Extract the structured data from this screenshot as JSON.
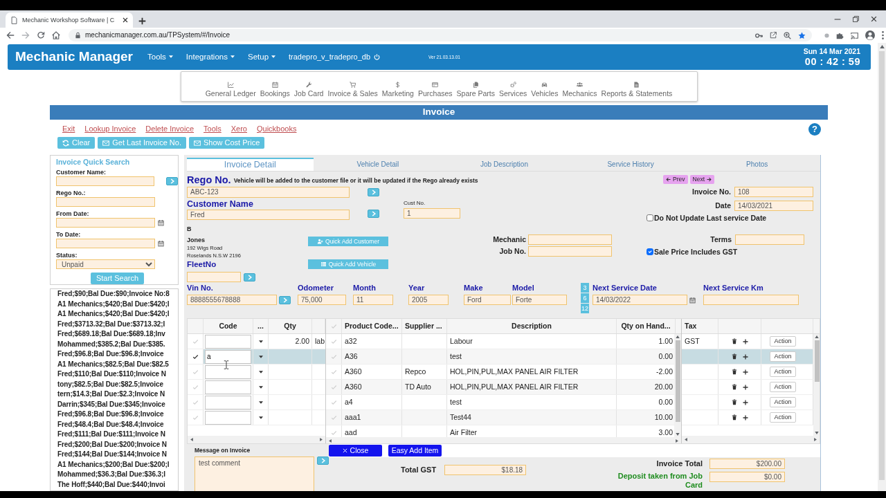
{
  "browser": {
    "tab_title": "Mechanic Workshop Software | C",
    "url": "mechanicmanager.com.au/TPSystem/#/Invoice"
  },
  "navbar": {
    "brand": "Mechanic Manager",
    "menus": [
      {
        "label": "Tools",
        "dropdown": true
      },
      {
        "label": "Integrations",
        "dropdown": true
      },
      {
        "label": "Setup",
        "dropdown": true
      }
    ],
    "database": "tradepro_v_tradepro_db",
    "version": "Ver 21.03.13.01",
    "date": "Sun 14 Mar 2021",
    "time": "00 : 42 : 59"
  },
  "modules": [
    "General Ledger",
    "Bookings",
    "Job Card",
    "Invoice & Sales",
    "Marketing",
    "Purchases",
    "Spare Parts",
    "Services",
    "Vehicles",
    "Mechanics",
    "Reports & Statements"
  ],
  "invoice": {
    "title": "Invoice",
    "links": [
      "Exit",
      "Lookup Invoice",
      "Delete Invoice",
      "Tools",
      "Xero",
      "Quickbooks"
    ],
    "buttons": [
      "Clear",
      "Get Last Invoice No.",
      "Show Cost Price"
    ],
    "help": "?"
  },
  "quick_search": {
    "title": "Invoice Quick Search",
    "fields": [
      {
        "label": "Customer Name:",
        "kind": "text",
        "go_button": true
      },
      {
        "label": "Rego No.:",
        "kind": "text",
        "go_button": false
      },
      {
        "label": "From Date:",
        "kind": "date",
        "go_button": false
      },
      {
        "label": "To Date:",
        "kind": "date",
        "go_button": false
      },
      {
        "label": "Status:",
        "kind": "select",
        "value": "Unpaid",
        "go_button": false
      }
    ],
    "button": "Start Search"
  },
  "results": [
    "Fred;$90;Bal Due:$90;Invoice No:8",
    "A1 Mechanics;$420;Bal Due:$420;I",
    "A1 Mechanics;$420;Bal Due:$420;I",
    "Fred;$3713.32;Bal Due:$3713.32;I",
    "Fred;$689.18;Bal Due:$689.18;Inv",
    "Mohammed;$385.2;Bal Due:$385.",
    "Fred;$96.8;Bal Due:$96.8;Invoice",
    "A1 Mechanics;$82.5;Bal Due:$82.5",
    "Fred;$110;Bal Due:$110;Invoice N",
    "tony;$82.5;Bal Due:$82.5;Invoice",
    "tern;$14.3;Bal Due:$2.3;Invoice N",
    "Darrin;$345;Bal Due:$345;Invoice",
    "Fred;$96.8;Bal Due:$96.8;Invoice",
    "Fred;$48.4;Bal Due:$48.4;Invoice",
    "Fred;$111;Bal Due:$111;Invoice N",
    "Fred;$200;Bal Due:$200;Invoice N",
    "Fred;$144;Bal Due:$144;Invoice N",
    "A1 Mechanics;$200;Bal Due:$200;I",
    "Mohammed;$36.3;Bal Due:$36.3;I",
    "The Hoff;$440;Bal Due:$440;Invoi"
  ],
  "tabs": [
    {
      "label": "Invoice Detail",
      "selected": true
    },
    {
      "label": "Vehicle Detail",
      "selected": false
    },
    {
      "label": "Job Description",
      "selected": false
    },
    {
      "label": "Service History",
      "selected": false
    },
    {
      "label": "Photos",
      "selected": false
    }
  ],
  "form": {
    "rego": {
      "label": "Rego No.",
      "note": "Vehicle will be added to the customer file or it will be updated if the Rego already exists",
      "value": "ABC-123"
    },
    "nav_buttons": [
      "Prev",
      "Next"
    ],
    "invoice_no": {
      "label": "Invoice No.",
      "value": "108"
    },
    "customer": {
      "label": "Customer Name",
      "value": "Fred"
    },
    "cust_no": {
      "label": "Cust No.",
      "value": "1"
    },
    "date": {
      "label": "Date",
      "value": "14/03/2021"
    },
    "checkboxes": [
      {
        "label": "Do Not Update Last service Date",
        "checked": false
      },
      {
        "label": "Sale Price Includes GST",
        "checked": true
      }
    ],
    "customer_details": {
      "first_name": "B",
      "last_name": "Jones",
      "address": [
        "192 Wigs Road",
        "Roselands N.S.W 2196"
      ]
    },
    "fleet_no": {
      "label": "FleetNo"
    },
    "quick_add_buttons": [
      "Quick Add Customer",
      "Quick Add Vehicle"
    ],
    "mechanic": {
      "label": "Mechanic"
    },
    "job_no": {
      "label": "Job No."
    },
    "terms": {
      "label": "Terms"
    },
    "vehicle": [
      {
        "label": "Vin No.",
        "value": "8888555678888"
      },
      {
        "label": "Odometer",
        "value": "75,000"
      },
      {
        "label": "Month",
        "value": "11"
      },
      {
        "label": "Year",
        "value": "2005"
      },
      {
        "label": "Make",
        "value": "Ford"
      },
      {
        "label": "Model",
        "value": "Forte"
      }
    ],
    "service_intervals": [
      "3",
      "6",
      "12"
    ],
    "next_service_date": {
      "label": "Next Service Date",
      "value": "14/03/2022"
    },
    "next_service_km": {
      "label": "Next Service Km"
    }
  },
  "item_grid": {
    "columns": [
      "Code",
      "...",
      "Qty"
    ],
    "tax_column": "Tax",
    "rows": [
      {
        "selected": false,
        "qty": "2.00",
        "column_5": "lab",
        "tax": "GST",
        "action": "Action"
      },
      {
        "selected": true,
        "code": "a",
        "action": "Action"
      },
      {
        "selected": false,
        "action": "Action"
      },
      {
        "selected": false,
        "action": "Action"
      },
      {
        "selected": false,
        "action": "Action"
      },
      {
        "selected": false,
        "action": "Action"
      }
    ]
  },
  "product_lookup": {
    "columns": [
      "Product Code...",
      "Supplier ...",
      "Description",
      "Qty on Hand..."
    ],
    "rows": [
      {
        "product_code": "a32",
        "description": "Labour",
        "qty_on_hand": "1.00"
      },
      {
        "product_code": "A36",
        "description": "test",
        "qty_on_hand": "0.00"
      },
      {
        "product_code": "A360",
        "supplier": "Repco",
        "description": "HOL,PIN,PUL,MAX PANEL AIR FILTER",
        "qty_on_hand": "-2.00"
      },
      {
        "product_code": "A360",
        "supplier": "TD Auto",
        "description": "HOL,PIN,PUL,MAX PANEL AIR FILTER",
        "qty_on_hand": "20.00"
      },
      {
        "product_code": "a4",
        "description": "test",
        "qty_on_hand": "0.00"
      },
      {
        "product_code": "aaa1",
        "description": "Test44",
        "qty_on_hand": "10.00"
      },
      {
        "product_code": "aad",
        "description": "Air Filter",
        "qty_on_hand": "3.00"
      }
    ],
    "buttons": [
      "Close",
      "Easy Add Item"
    ]
  },
  "message": {
    "label": "Message on Invoice",
    "value": "test comment"
  },
  "totals": {
    "gst": {
      "label": "Total GST",
      "value": "$18.18"
    },
    "invoice_total": {
      "label": "Invoice Total",
      "value": "$200.00"
    },
    "deposit": {
      "label": "Deposit taken from Job Card",
      "value": "$0.00"
    }
  }
}
